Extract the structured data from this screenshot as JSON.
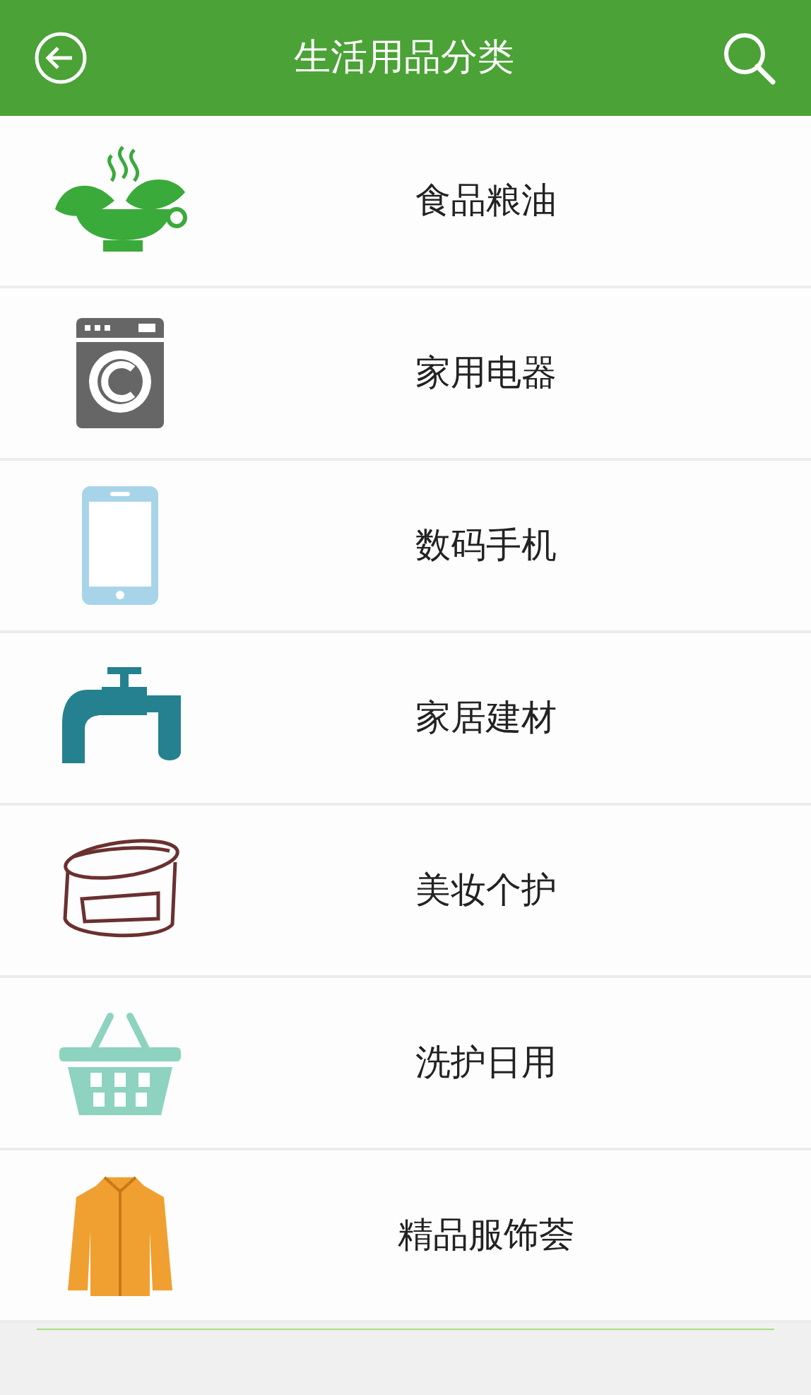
{
  "header": {
    "title": "生活用品分类"
  },
  "categories": [
    {
      "label": "食品粮油"
    },
    {
      "label": "家用电器"
    },
    {
      "label": "数码手机"
    },
    {
      "label": "家居建材"
    },
    {
      "label": "美妆个护"
    },
    {
      "label": "洗护日用"
    },
    {
      "label": "精品服饰荟"
    }
  ]
}
